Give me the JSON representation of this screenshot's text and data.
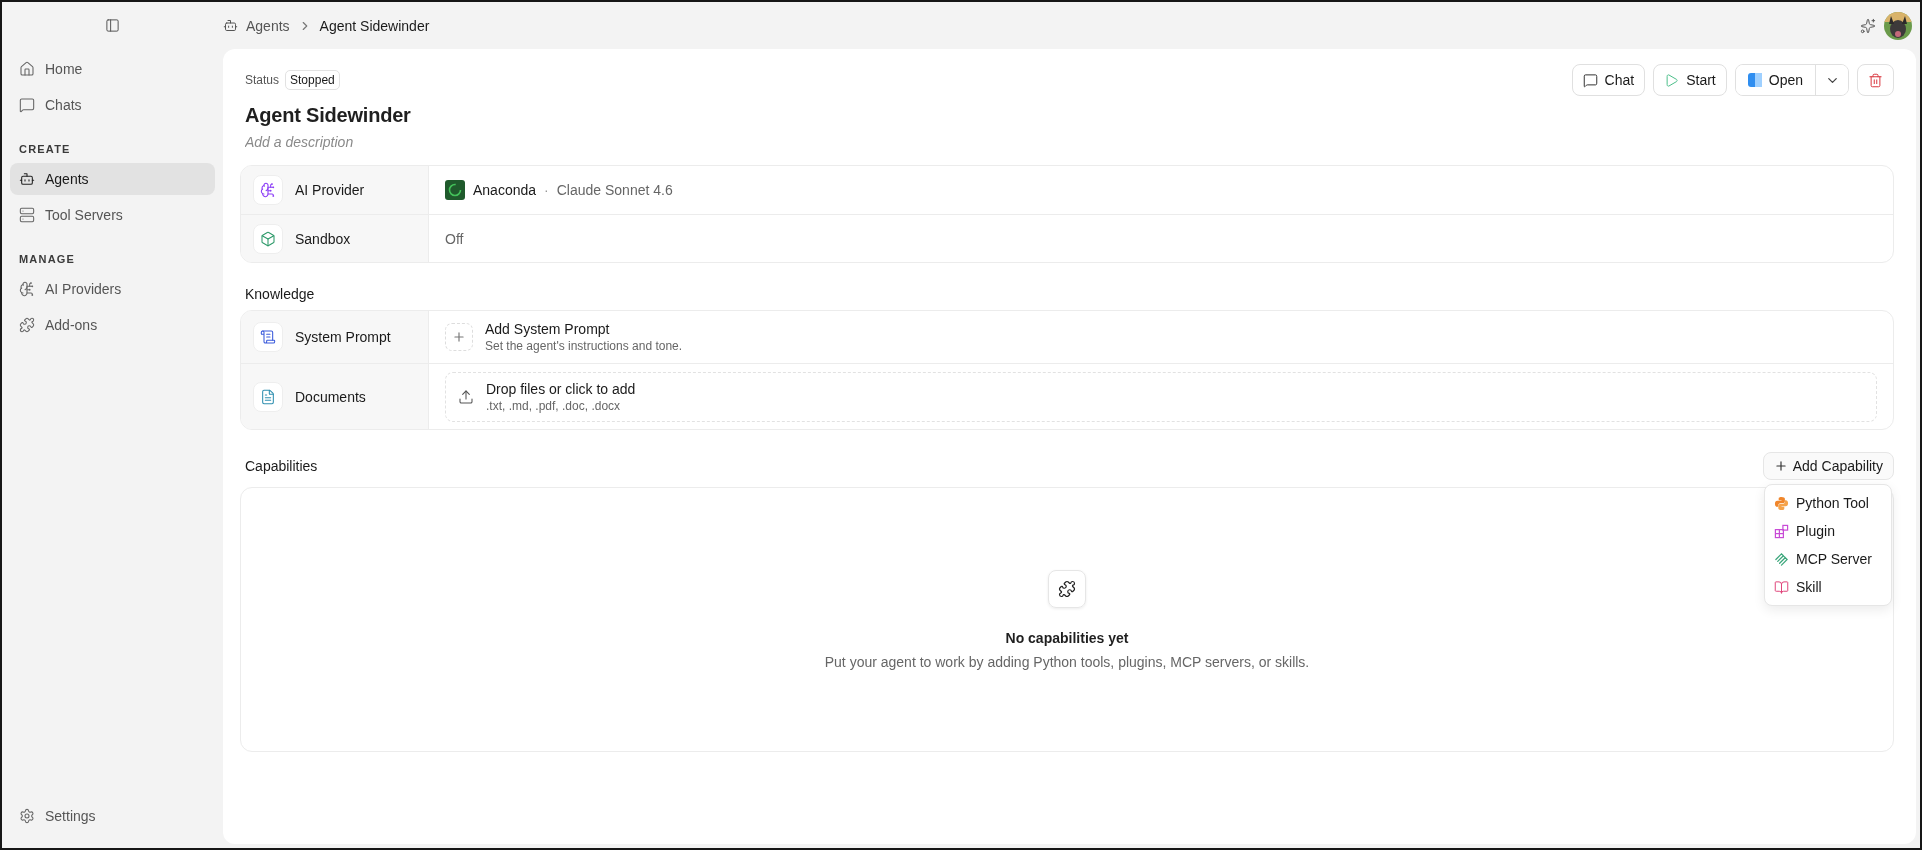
{
  "sidebar": {
    "sections": [
      {
        "items": [
          {
            "label": "Home",
            "selected": false
          },
          {
            "label": "Chats",
            "selected": false
          }
        ]
      },
      {
        "heading": "CREATE",
        "items": [
          {
            "label": "Agents",
            "selected": true
          },
          {
            "label": "Tool Servers",
            "selected": false
          }
        ]
      },
      {
        "heading": "MANAGE",
        "items": [
          {
            "label": "AI Providers",
            "selected": false
          },
          {
            "label": "Add-ons",
            "selected": false
          }
        ]
      }
    ],
    "footer": {
      "label": "Settings"
    }
  },
  "breadcrumb": [
    {
      "label": "Agents"
    },
    {
      "label": "Agent Sidewinder"
    }
  ],
  "agent": {
    "status_label": "Status",
    "status": "Stopped",
    "title": "Agent Sidewinder",
    "description_placeholder": "Add a description"
  },
  "actions": [
    {
      "label": "Chat",
      "kind": "chat"
    },
    {
      "label": "Start",
      "kind": "start"
    },
    {
      "label": "Open",
      "kind": "open"
    },
    {
      "kind": "delete"
    }
  ],
  "settings": [
    {
      "label": "AI Provider",
      "kind": "provider",
      "value": "Anaconda",
      "separator": "·",
      "detail": "Claude Sonnet 4.6"
    },
    {
      "label": "Sandbox",
      "kind": "plain",
      "value": "Off"
    }
  ],
  "knowledge": {
    "heading": "Knowledge",
    "rows": [
      {
        "label": "System Prompt",
        "kind": "add",
        "title": "Add System Prompt",
        "subtitle": "Set the agent's instructions and tone."
      },
      {
        "label": "Documents",
        "kind": "drop",
        "title": "Drop files or click to add",
        "subtitle": ".txt, .md, .pdf, .doc, .docx"
      }
    ]
  },
  "capabilities": {
    "heading": "Capabilities",
    "add_button": "Add Capability",
    "menu": [
      {
        "label": "Python Tool"
      },
      {
        "label": "Plugin"
      },
      {
        "label": "MCP Server"
      },
      {
        "label": "Skill"
      }
    ],
    "empty_title": "No capabilities yet",
    "empty_text": "Put your agent to work by adding Python tools, plugins, MCP servers, or skills."
  }
}
